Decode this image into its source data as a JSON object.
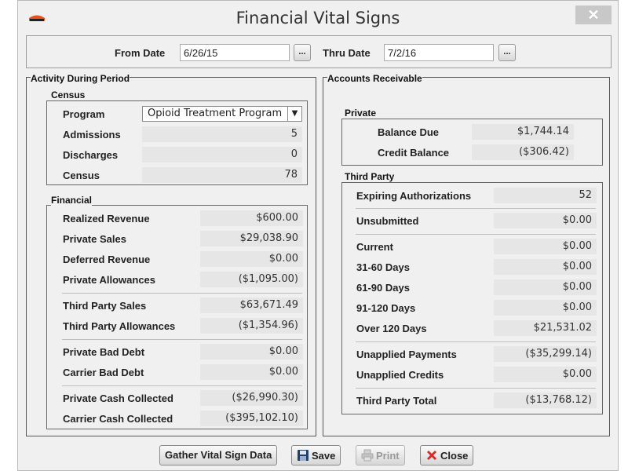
{
  "window": {
    "title": "Financial Vital Signs",
    "close_glyph": "✕"
  },
  "dates": {
    "from_label": "From Date",
    "from_value": "6/26/15",
    "thru_label": "Thru Date",
    "thru_value": "7/2/16",
    "picker_label": "..."
  },
  "activity": {
    "title": "Activity During Period",
    "census": {
      "title": "Census",
      "program_label": "Program",
      "program_value": "Opioid Treatment Program",
      "rows": [
        {
          "label": "Admissions",
          "value": "5"
        },
        {
          "label": "Discharges",
          "value": "0"
        },
        {
          "label": "Census",
          "value": "78"
        }
      ]
    },
    "financial": {
      "title": "Financial",
      "rows": [
        {
          "label": "Realized Revenue",
          "value": "$600.00"
        },
        {
          "label": "Private Sales",
          "value": "$29,038.90"
        },
        {
          "label": "Deferred Revenue",
          "value": "$0.00"
        },
        {
          "label": "Private Allowances",
          "value": "($1,095.00)"
        },
        {
          "label": "Third Party Sales",
          "value": "$63,671.49"
        },
        {
          "label": "Third Party Allowances",
          "value": "($1,354.96)"
        },
        {
          "label": "Private Bad Debt",
          "value": "$0.00"
        },
        {
          "label": "Carrier Bad Debt",
          "value": "$0.00"
        },
        {
          "label": "Private Cash Collected",
          "value": "($26,990.30)"
        },
        {
          "label": "Carrier Cash Collected",
          "value": "($395,102.10)"
        }
      ]
    }
  },
  "receivable": {
    "title": "Accounts Receivable",
    "private": {
      "title": "Private",
      "rows": [
        {
          "label": "Balance Due",
          "value": "$1,744.14"
        },
        {
          "label": "Credit Balance",
          "value": "($306.42)"
        }
      ]
    },
    "third_party": {
      "title": "Third Party",
      "rows": [
        {
          "label": "Expiring Authorizations",
          "value": "52"
        },
        {
          "label": "Unsubmitted",
          "value": "$0.00"
        },
        {
          "label": "Current",
          "value": "$0.00"
        },
        {
          "label": "31-60 Days",
          "value": "$0.00"
        },
        {
          "label": "61-90 Days",
          "value": "$0.00"
        },
        {
          "label": "91-120 Days",
          "value": "$0.00"
        },
        {
          "label": "Over 120 Days",
          "value": "$21,531.02"
        },
        {
          "label": "Unapplied Payments",
          "value": "($35,299.14)"
        },
        {
          "label": "Unapplied Credits",
          "value": "$0.00"
        },
        {
          "label": "Third Party Total",
          "value": "($13,768.12)"
        }
      ]
    }
  },
  "buttons": {
    "gather": "Gather Vital Sign Data",
    "save": "Save",
    "print": "Print",
    "close": "Close"
  },
  "icons": {
    "app": "app-logo-icon",
    "save": "floppy-disk-icon",
    "print": "printer-icon",
    "close": "red-x-icon"
  },
  "colors": {
    "accent": "#e8501c",
    "close_red": "#d62b2b"
  }
}
